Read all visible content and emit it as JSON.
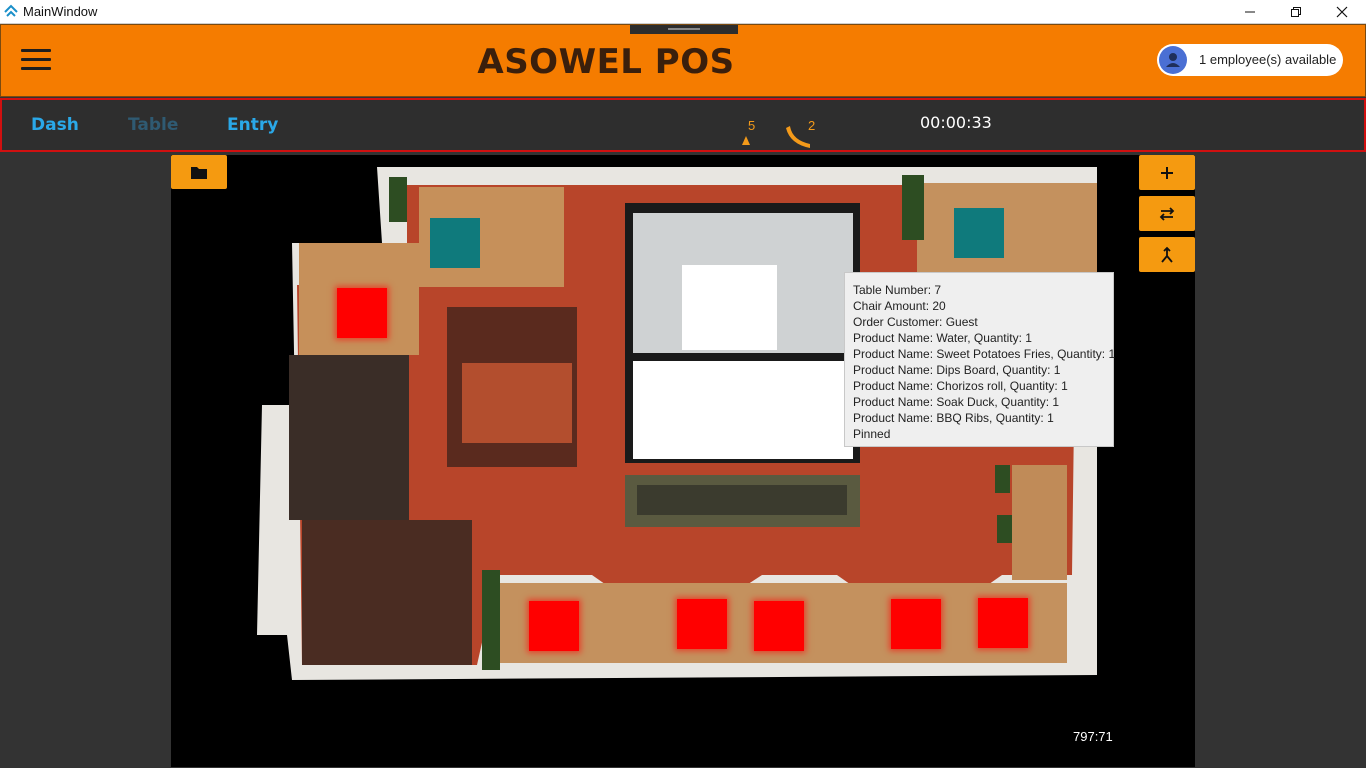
{
  "window": {
    "title": "MainWindow"
  },
  "header": {
    "brand": "ASOWEL POS",
    "employees_label": "1 employee(s) available"
  },
  "nav": {
    "tabs": [
      {
        "label": "Dash",
        "active": false
      },
      {
        "label": "Table",
        "active": true
      },
      {
        "label": "Entry",
        "active": false
      }
    ],
    "gauge_left_value": "5",
    "gauge_right_value": "2",
    "timer": "00:00:33"
  },
  "map": {
    "coordinates_readout": "797:71",
    "tables": [
      {
        "status": "red"
      },
      {
        "status": "red"
      },
      {
        "status": "red"
      },
      {
        "status": "red"
      },
      {
        "status": "red"
      },
      {
        "status": "red"
      },
      {
        "status": "teal"
      },
      {
        "status": "teal"
      }
    ]
  },
  "tooltip": {
    "lines": [
      "Table Number: 7",
      "Chair Amount: 20",
      "Order Customer: Guest",
      "Product Name: Water, Quantity: 1",
      "Product Name: Sweet Potatoes Fries, Quantity: 1",
      "Product Name: Dips Board, Quantity: 1",
      "Product Name: Chorizos roll, Quantity: 1",
      "Product Name: Soak Duck, Quantity: 1",
      "Product Name: BBQ Ribs, Quantity: 1",
      "Pinned"
    ]
  },
  "colors": {
    "accent_orange": "#f57c00",
    "button_orange": "#f59a10",
    "tab_blue": "#2aa8e8",
    "occupied_red": "#ff0000",
    "free_teal": "#0f7a7c",
    "nav_border": "#d01010"
  },
  "icons": {
    "menu": "hamburger-icon",
    "user": "user-icon",
    "folder": "folder-icon",
    "add": "plus-icon",
    "swap": "swap-arrows-icon",
    "merge": "merge-icon"
  }
}
